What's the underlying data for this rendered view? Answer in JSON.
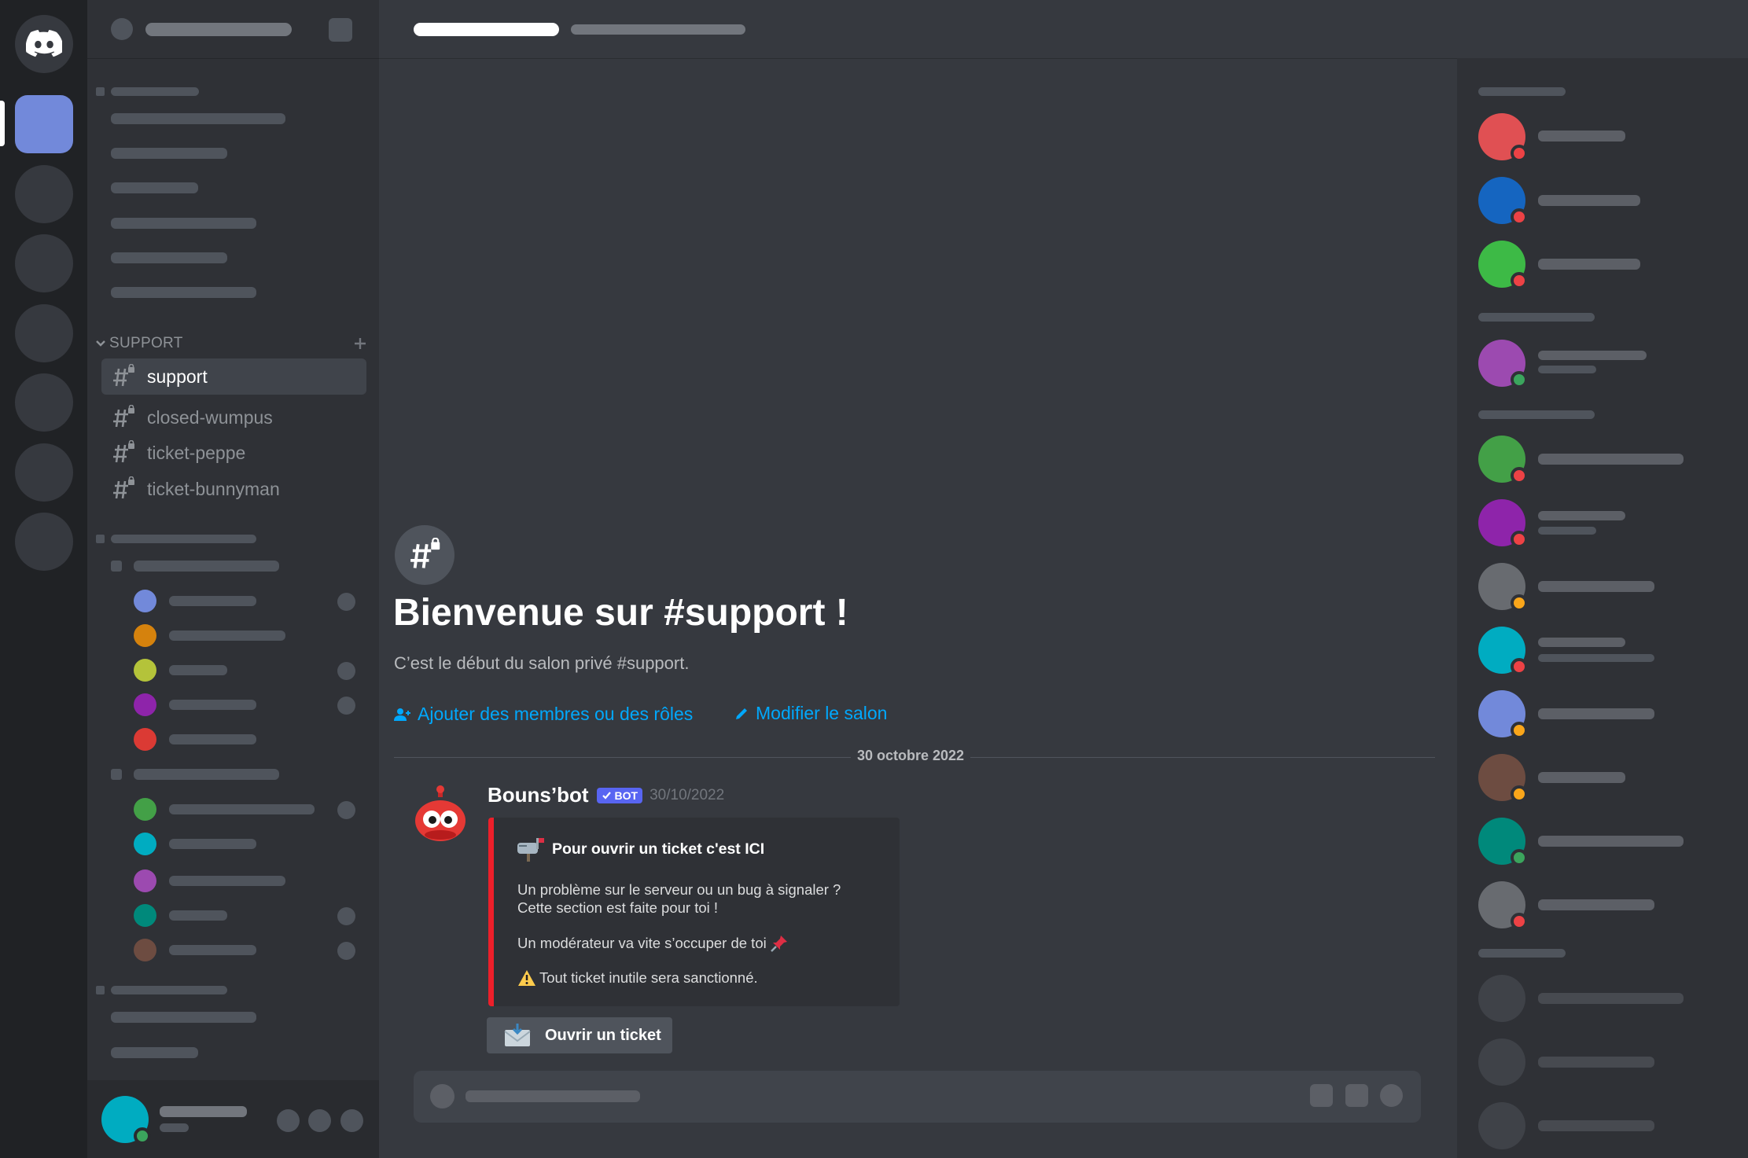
{
  "server": {
    "category": "SUPPORT",
    "channels": [
      {
        "label": "support",
        "active": true
      },
      {
        "label": "closed-wumpus",
        "active": false
      },
      {
        "label": "ticket-peppe",
        "active": false
      },
      {
        "label": "ticket-bunnyman",
        "active": false
      }
    ]
  },
  "welcome": {
    "title": "Bienvenue sur #support !",
    "subtitle": "C’est le début du salon privé #support.",
    "add_members": "Ajouter des membres ou des rôles",
    "edit_channel": "Modifier le salon"
  },
  "divider_date": "30 octobre 2022",
  "message": {
    "author": "Bouns’bot",
    "badge": "BOT",
    "timestamp": "30/10/2022",
    "embed": {
      "title": "Pour ouvrir un ticket c'est ICI",
      "line1": "Un problème sur le serveur ou un bug à signaler ?",
      "line2": "Cette section est faite pour toi !",
      "line3": "Un modérateur va vite s’occuper de toi",
      "line4": "Tout ticket inutile sera sanctionné."
    },
    "button": "Ouvrir un ticket"
  },
  "colors": {
    "accent": "#7289da",
    "link": "#00a8fc",
    "embed_border": "#ed1f2a",
    "online": "#3ba55d",
    "dnd": "#ed4245",
    "idle": "#faa61a"
  }
}
